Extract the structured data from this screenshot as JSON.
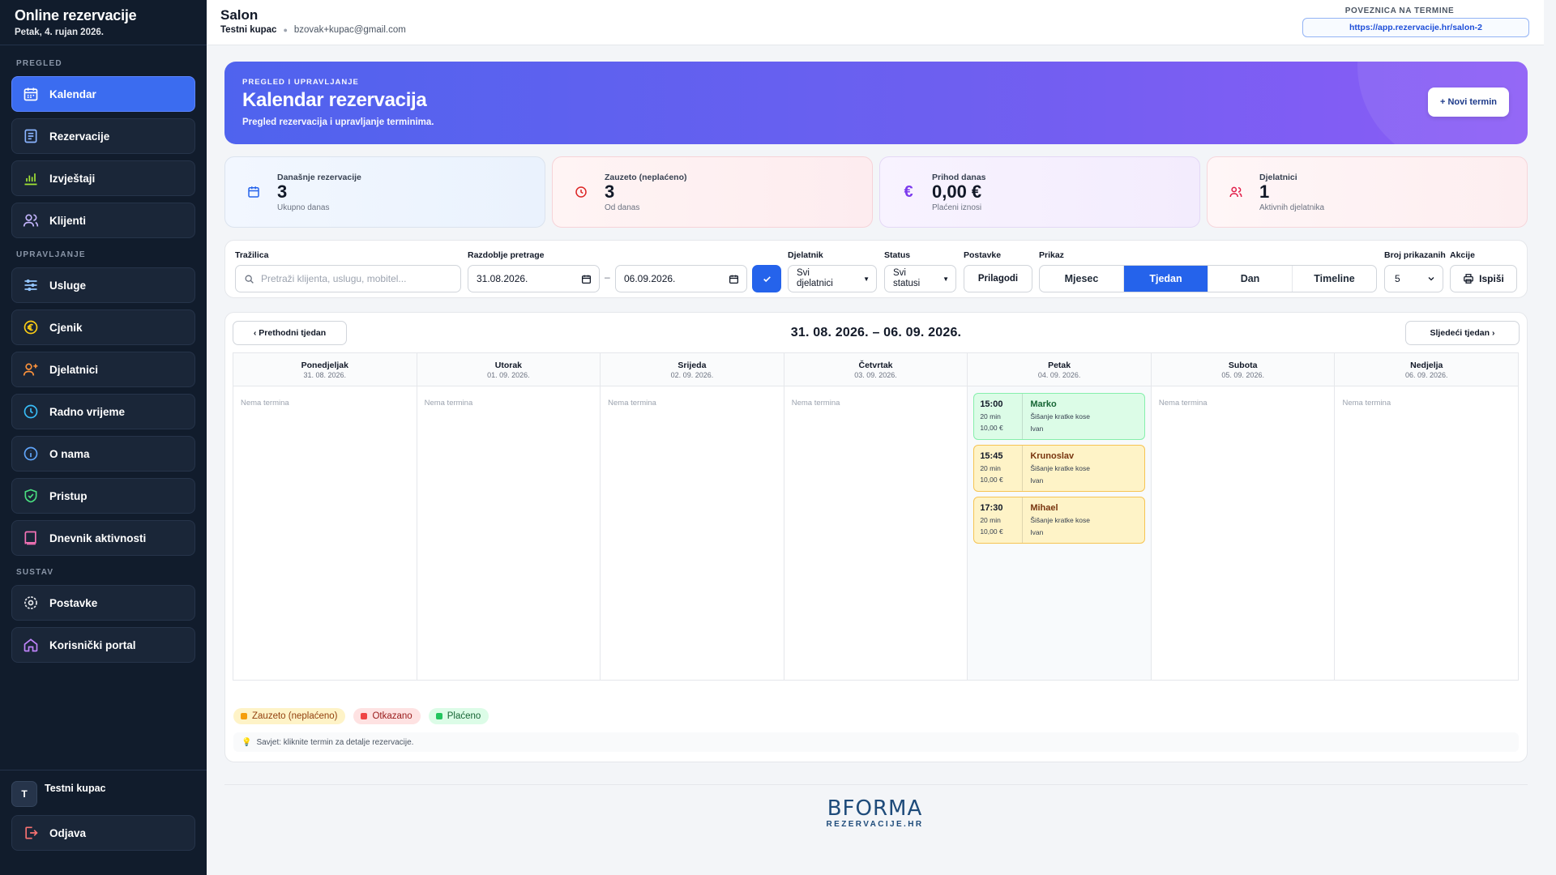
{
  "sidebar": {
    "title": "Online rezervacije",
    "date": "Petak, 4. rujan 2026.",
    "sections": {
      "pregled": "PREGLED",
      "upravljanje": "UPRAVLJANJE",
      "sustav": "SUSTAV"
    },
    "items": [
      {
        "label": "Kalendar",
        "icon": "calendar-icon"
      },
      {
        "label": "Rezervacije",
        "icon": "list-icon"
      },
      {
        "label": "Izvještaji",
        "icon": "bar-chart-icon"
      },
      {
        "label": "Klijenti",
        "icon": "users-icon"
      },
      {
        "label": "Usluge",
        "icon": "sliders-icon"
      },
      {
        "label": "Cjenik",
        "icon": "euro-icon"
      },
      {
        "label": "Djelatnici",
        "icon": "user-plus-icon"
      },
      {
        "label": "Radno vrijeme",
        "icon": "clock-icon"
      },
      {
        "label": "O nama",
        "icon": "info-icon"
      },
      {
        "label": "Pristup",
        "icon": "shield-icon"
      },
      {
        "label": "Dnevnik aktivnosti",
        "icon": "activity-icon"
      },
      {
        "label": "Postavke",
        "icon": "gear-icon"
      },
      {
        "label": "Korisnički portal",
        "icon": "home-icon"
      }
    ],
    "user": {
      "initial": "T",
      "name": "Testni kupac"
    },
    "logout": "Odjava"
  },
  "topbar": {
    "title": "Salon",
    "user": "Testni kupac",
    "email": "bzovak+kupac@gmail.com",
    "link_label": "POVEZNICA NA TERMINE",
    "link_url": "https://app.rezervacije.hr/salon-2"
  },
  "hero": {
    "kicker": "PREGLED I UPRAVLJANJE",
    "title": "Kalendar rezervacija",
    "subtitle": "Pregled rezervacija i upravljanje terminima.",
    "button": "+ Novi termin"
  },
  "stats": [
    {
      "label": "Današnje rezervacije",
      "value": "3",
      "hint": "Ukupno danas",
      "icon": "calendar-icon"
    },
    {
      "label": "Zauzeto (neplaćeno)",
      "value": "3",
      "hint": "Od danas",
      "icon": "clock-icon"
    },
    {
      "label": "Prihod danas",
      "value": "0,00 €",
      "hint": "Plaćeni iznosi",
      "icon": "euro-icon"
    },
    {
      "label": "Djelatnici",
      "value": "1",
      "hint": "Aktivnih djelatnika",
      "icon": "users-icon"
    }
  ],
  "filters": {
    "search_label": "Tražilica",
    "search_placeholder": "Pretraži klijenta, uslugu, mobitel...",
    "period_label": "Razdoblje pretrage",
    "date_from": "31.08.2026.",
    "date_to": "06.09.2026.",
    "date_sep": "–",
    "employee_label": "Djelatnik",
    "employee_value": "Svi djelatnici",
    "status_label": "Status",
    "status_value": "Svi statusi",
    "settings_label": "Postavke",
    "settings_button": "Prilagodi",
    "view_label": "Prikaz",
    "views": [
      "Mjesec",
      "Tjedan",
      "Dan",
      "Timeline"
    ],
    "active_view": "Tjedan",
    "count_label": "Broj prikazanih",
    "count_value": "5",
    "actions_label": "Akcije",
    "print_button": "Ispiši"
  },
  "calendar": {
    "prev": "‹ Prethodni tjedan",
    "next": "Sljedeći tjedan ›",
    "range": "31. 08. 2026. – 06. 09. 2026.",
    "empty_text": "Nema termina",
    "days": [
      {
        "name": "Ponedjeljak",
        "date": "31. 08. 2026."
      },
      {
        "name": "Utorak",
        "date": "01. 09. 2026."
      },
      {
        "name": "Srijeda",
        "date": "02. 09. 2026."
      },
      {
        "name": "Četvrtak",
        "date": "03. 09. 2026."
      },
      {
        "name": "Petak",
        "date": "04. 09. 2026."
      },
      {
        "name": "Subota",
        "date": "05. 09. 2026."
      },
      {
        "name": "Nedjelja",
        "date": "06. 09. 2026."
      }
    ],
    "appointments": [
      {
        "time": "15:00",
        "duration": "20 min",
        "price": "10,00 €",
        "client": "Marko",
        "service": "Šišanje kratke kose",
        "employee": "Ivan",
        "status": "Plaćeno"
      },
      {
        "time": "15:45",
        "duration": "20 min",
        "price": "10,00 €",
        "client": "Krunoslav",
        "service": "Šišanje kratke kose",
        "employee": "Ivan",
        "status": "Zauzeto (neplaćeno)"
      },
      {
        "time": "17:30",
        "duration": "20 min",
        "price": "10,00 €",
        "client": "Mihael",
        "service": "Šišanje kratke kose",
        "employee": "Ivan",
        "status": "Zauzeto (neplaćeno)"
      }
    ],
    "legend": [
      "Zauzeto (neplaćeno)",
      "Otkazano",
      "Plaćeno"
    ],
    "tip": "Savjet: kliknite termin za detalje rezervacije."
  },
  "footer": {
    "logo_main": "BFORMA",
    "logo_sub": "REZERVACIJE.HR"
  },
  "colors": {
    "accent": "#3b6cf0",
    "sidebar": "#111c2c",
    "paid": "#22c55e",
    "unpaid": "#f59e0b",
    "cancelled": "#ef4444"
  }
}
